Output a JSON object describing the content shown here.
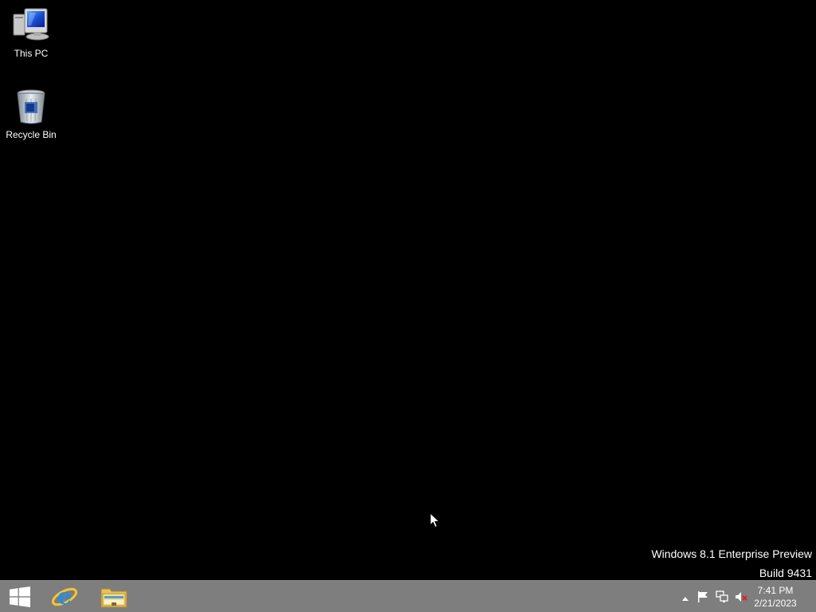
{
  "desktop": {
    "icons": [
      {
        "label": "This PC",
        "icon": "computer-icon"
      },
      {
        "label": "Recycle Bin",
        "icon": "recycle-bin-icon"
      }
    ],
    "watermark": {
      "line1": "Windows 8.1 Enterprise Preview",
      "line2": "Build 9431"
    }
  },
  "taskbar": {
    "pinned": [
      {
        "name": "start",
        "icon": "windows-logo-icon"
      },
      {
        "name": "internet-explorer",
        "icon": "internet-explorer-icon"
      },
      {
        "name": "file-explorer",
        "icon": "folder-icon"
      }
    ],
    "tray": {
      "icons": [
        "chevron-up-icon",
        "flag-icon",
        "network-icon",
        "volume-muted-icon"
      ],
      "time": "7:41 PM",
      "date": "2/21/2023"
    }
  },
  "colors": {
    "desktop_bg": "#000000",
    "taskbar_bg": "#7e7e7e",
    "text": "#ffffff"
  }
}
